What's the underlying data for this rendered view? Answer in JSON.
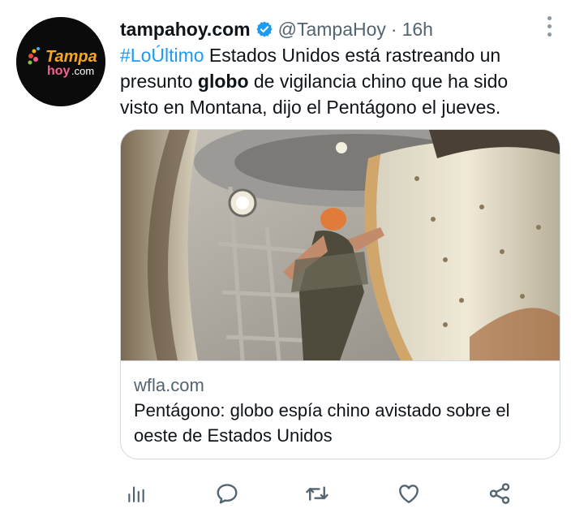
{
  "tweet": {
    "display_name": "tampahoy.com",
    "handle": "@TampaHoy",
    "separator": "·",
    "time": "16h",
    "text": {
      "hashtag": "#LoÚltimo",
      "part1": " Estados Unidos está rastreando un presunto ",
      "bold": "globo",
      "part2": " de vigilancia chino que ha sido visto en Montana, dijo el Pentágono el jueves."
    }
  },
  "avatar": {
    "logo_word1": "Tampa",
    "logo_word2": "hoy",
    "logo_suffix": ".com"
  },
  "card": {
    "domain": "wfla.com",
    "title": "Pentágono: globo espía chino avistado sobre el oeste de Estados Unidos"
  },
  "icons": {
    "verified": "verified-badge-icon",
    "more": "more-options-icon",
    "analytics": "analytics-icon",
    "reply": "reply-icon",
    "retweet": "retweet-icon",
    "like": "like-icon",
    "share": "share-icon"
  },
  "colors": {
    "link": "#1d9bf0",
    "muted": "#536471",
    "text": "#0f1419",
    "border": "#cfd9de"
  }
}
